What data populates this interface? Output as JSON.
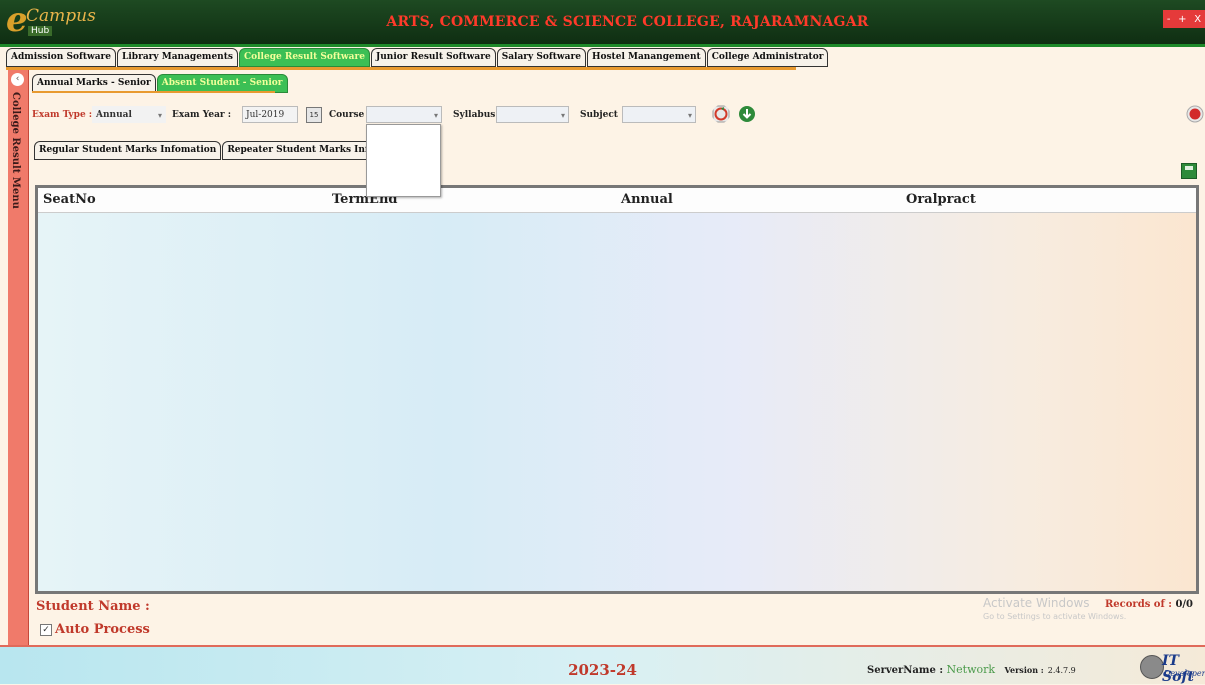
{
  "window": {
    "logo_main": "Campus",
    "logo_sub": "Hub",
    "college_name": "ARTS, COMMERCE & SCIENCE COLLEGE, RAJARAMNAGAR",
    "controls": [
      "-",
      "+",
      "X"
    ]
  },
  "module_tabs": [
    {
      "label": "Admission Software",
      "active": false
    },
    {
      "label": "Library Managements",
      "active": false
    },
    {
      "label": "College Result Software",
      "active": true
    },
    {
      "label": "Junior Result Software",
      "active": false
    },
    {
      "label": "Salary Software",
      "active": false
    },
    {
      "label": "Hostel Manangement",
      "active": false
    },
    {
      "label": "College Administrator",
      "active": false
    }
  ],
  "sidebar": {
    "title": "College Result Menu"
  },
  "sub_tabs": [
    {
      "label": "Annual Marks - Senior",
      "active": false
    },
    {
      "label": "Absent Student - Senior",
      "active": true
    }
  ],
  "filters": {
    "exam_type_label": "Exam Type :",
    "exam_type_value": "Annual",
    "exam_year_label": "Exam Year :",
    "exam_year_value": "Jul-2019",
    "calendar_day": "15",
    "course_label": "Course",
    "course_value": "",
    "syllabus_label": "Syllabus",
    "syllabus_value": "",
    "subject_label": "Subject",
    "subject_value": ""
  },
  "inner_tabs": [
    {
      "label": "Regular Student Marks Infomation"
    },
    {
      "label": "Repeater Student Marks Infom"
    }
  ],
  "grid": {
    "columns": [
      "SeatNo",
      "TermEnd",
      "Annual",
      "Oralpract"
    ],
    "rows": []
  },
  "footer": {
    "student_name_label": "Student Name :",
    "auto_process_label": "Auto Process",
    "auto_process_checked": true,
    "activate_title": "Activate Windows",
    "activate_sub": "Go to Settings to activate Windows.",
    "records_label": "Records of :",
    "records_value": "0/0"
  },
  "statusbar": {
    "academic_year": "2023-24",
    "server_label": "ServerName :",
    "server_value": "Network",
    "version_label": "Version :",
    "version_value": "2.4.7.9",
    "vendor_logo": "IT Soft",
    "vendor_sub": "Developers"
  },
  "colors": {
    "accent_red": "#c0392b",
    "active_tab_green": "#3cbf55",
    "sidebar_salmon": "#f07a6a",
    "title_green": "#1e4a22"
  }
}
